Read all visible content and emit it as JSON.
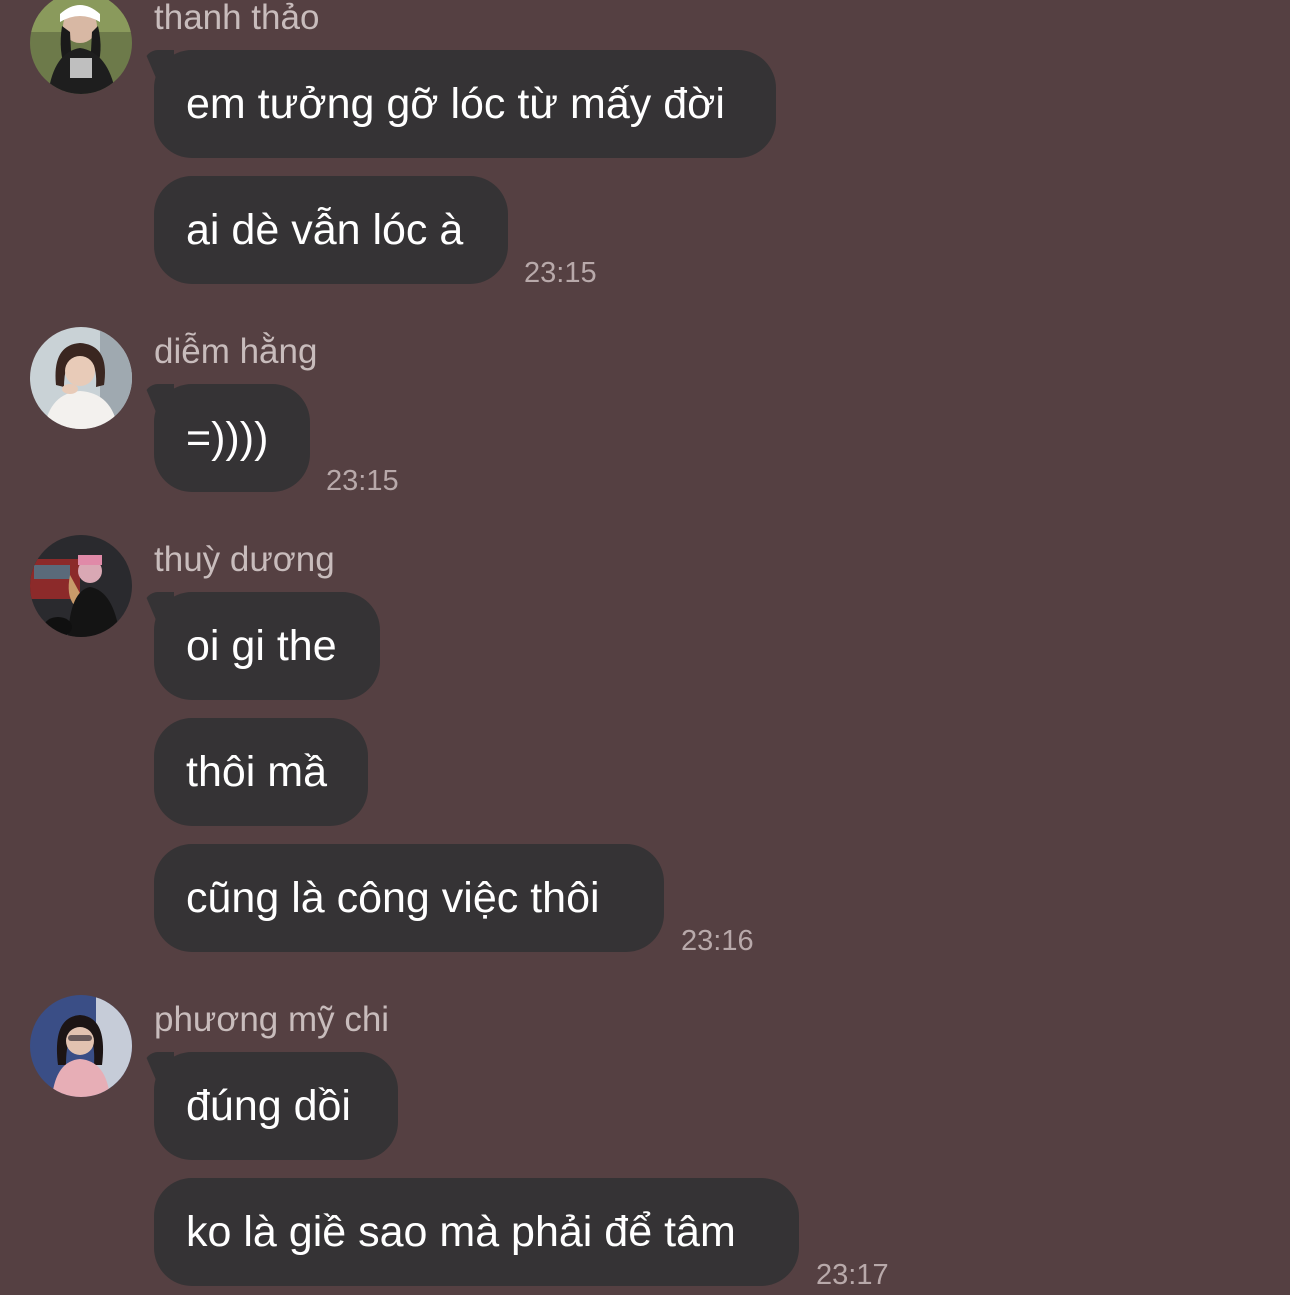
{
  "groups": [
    {
      "sender": "thanh thảo",
      "avatar_icon": "user-avatar-photo",
      "messages": [
        "em tưởng gỡ lóc từ mấy đời",
        "ai dè vẫn lóc à"
      ],
      "time": "23:15"
    },
    {
      "sender": "diễm hằng",
      "avatar_icon": "user-avatar-photo",
      "messages": [
        "=))))"
      ],
      "time": "23:15"
    },
    {
      "sender": "thuỳ dương",
      "avatar_icon": "user-avatar-photo",
      "messages": [
        "oi gi the",
        "thôi mầ",
        "cũng là công việc thôi"
      ],
      "time": "23:16"
    },
    {
      "sender": "phương mỹ chi",
      "avatar_icon": "user-avatar-photo",
      "messages": [
        "đúng dồi",
        "ko là giề sao mà phải để tâm"
      ],
      "time": "23:17"
    }
  ],
  "colors": {
    "background": "#554042",
    "bubble": "#353335",
    "message_text": "#ffffff",
    "sender_text": "#c8bcbc",
    "timestamp_text": "#b8a9aa"
  }
}
